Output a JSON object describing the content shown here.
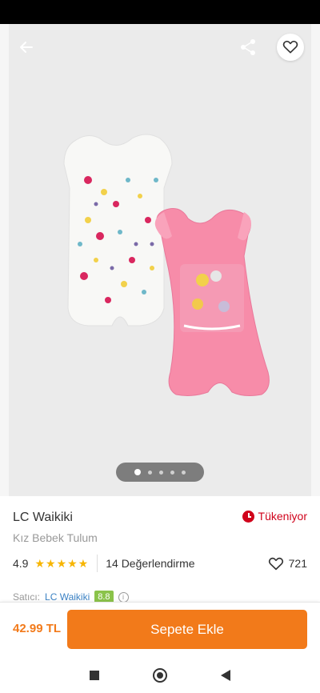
{
  "product": {
    "brand": "LC Waikiki",
    "name": "Kız Bebek Tulum",
    "stock_status": "Tükeniyor",
    "rating": "4.9",
    "stars": "★★★★★",
    "review_count": "14 Değerlendirme",
    "favorite_count": "721",
    "image_count": 5,
    "active_image": 1
  },
  "seller": {
    "label": "Satıcı:",
    "name": "LC Waikiki",
    "score": "8.8",
    "info_glyph": "i"
  },
  "purchase": {
    "price": "42.99 TL",
    "cart_label": "Sepete Ekle"
  },
  "icons": {
    "back": "arrow-left-icon",
    "share": "share-icon",
    "favorite": "heart-icon",
    "stock": "clock-icon"
  },
  "colors": {
    "accent": "#f27a1a",
    "stock_warning": "#d0021b",
    "star": "#f7b500",
    "seller_score": "#8bc34a",
    "link": "#3b82c4"
  }
}
